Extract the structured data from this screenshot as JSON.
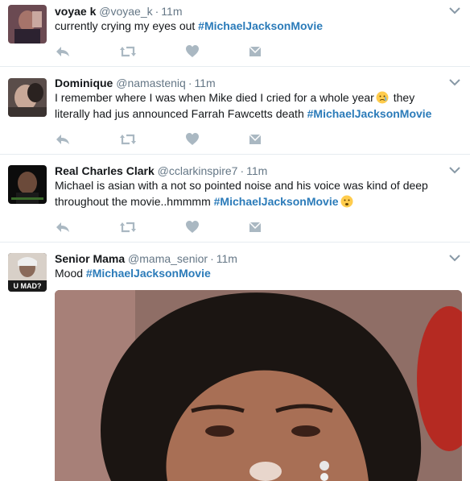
{
  "tweets": [
    {
      "name": "voyae k",
      "handle": "@voyae_k",
      "dot": "·",
      "time": "11m",
      "text_before": "currently crying my eyes out ",
      "hashtag": "#MichaelJacksonMovie",
      "text_after": ""
    },
    {
      "name": "Dominique",
      "handle": "@namasteniq",
      "dot": "·",
      "time": "11m",
      "text_line1": "I remember where I was when Mike died I cried for a whole year",
      "text_line1b": " they",
      "text_line2": "literally had jus announced Farrah Fawcetts death ",
      "hashtag": "#MichaelJacksonMovie"
    },
    {
      "name": "Real Charles Clark",
      "handle": "@cclarkinspire7",
      "dot": "·",
      "time": "11m",
      "text_line1": "Michael is asian with a not so pointed noise and his voice was kind of deep",
      "text_line2": "throughout the movie..hmmmm ",
      "hashtag": "#MichaelJacksonMovie"
    },
    {
      "name": "Senior Mama",
      "handle": "@mama_senior",
      "dot": "·",
      "time": "11m",
      "text_before": "Mood ",
      "hashtag": "#MichaelJacksonMovie",
      "avatar_text": "U MAD?"
    }
  ],
  "icons": {
    "reply": "reply-icon",
    "retweet": "retweet-icon",
    "like": "heart-icon",
    "dm": "direct-message-icon",
    "more": "chevron-down-icon"
  },
  "colors": {
    "hashtag": "#2b7bb9",
    "muted": "#657786",
    "action": "#aab8c2",
    "divider": "#e6ecf0"
  }
}
